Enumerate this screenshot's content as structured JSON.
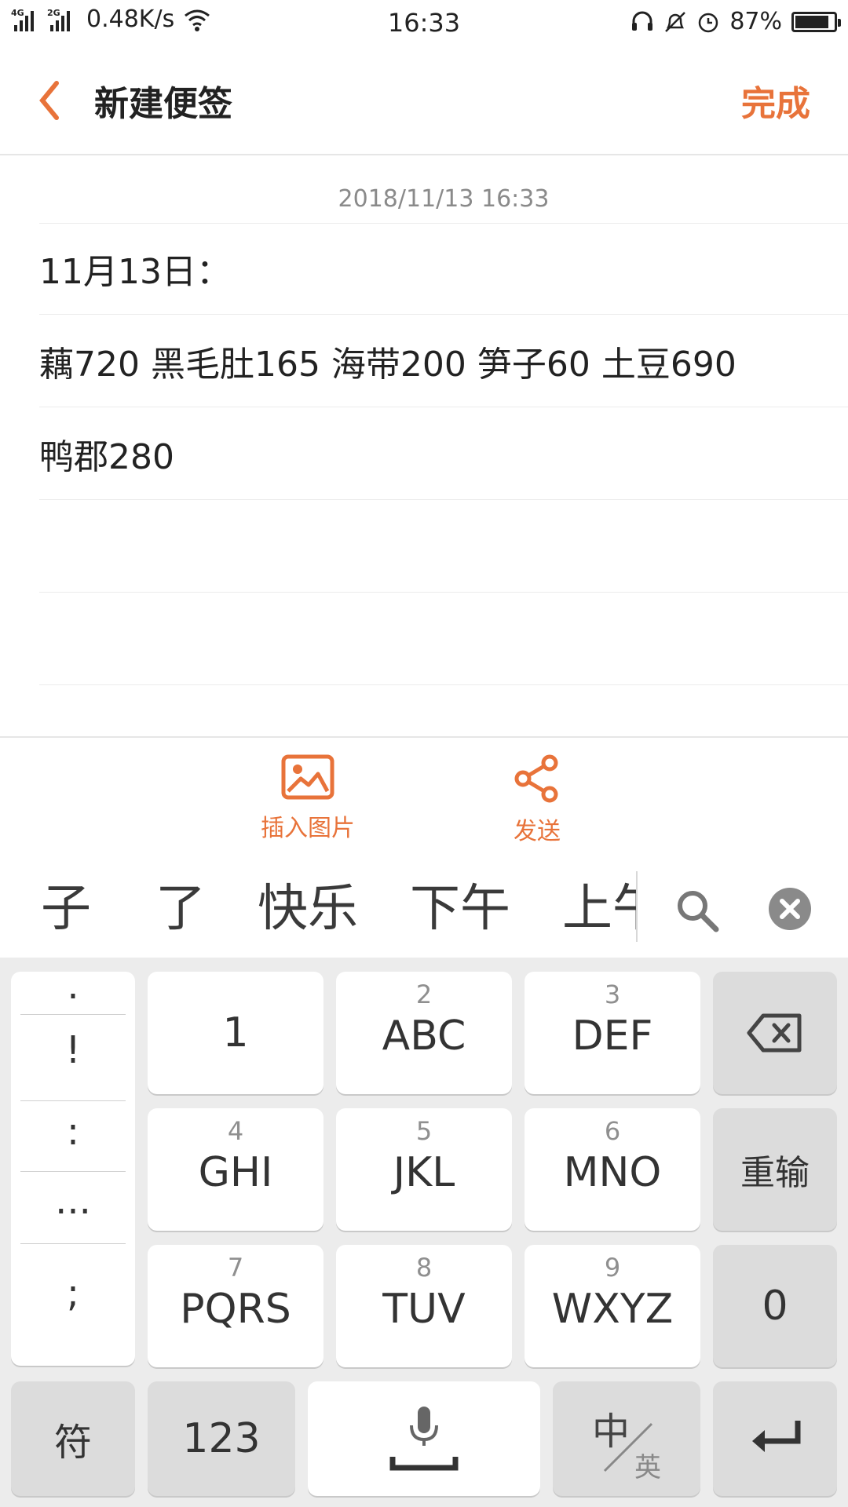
{
  "status_bar": {
    "net1": "4G",
    "net2": "2G",
    "speed": "0.48K/s",
    "time": "16:33",
    "battery": "87%",
    "battery_level": 0.87,
    "icons": [
      "signal-icon",
      "wifi-icon",
      "headset-icon",
      "mute-icon",
      "alarm-icon",
      "battery-icon"
    ]
  },
  "header": {
    "title": "新建便签",
    "done_label": "完成"
  },
  "note": {
    "date": "2018/11/13 16:33",
    "lines": [
      "11月13日：",
      "藕720  黑毛肚165  海带200  笋子60  土豆690",
      "鸭郡280"
    ]
  },
  "toolbar": {
    "insert_image": "插入图片",
    "send": "发送"
  },
  "candidates": [
    "子",
    "了",
    "快乐",
    "下午",
    "上午"
  ],
  "keyboard": {
    "punctuation": [
      ".",
      "!",
      ":",
      "...",
      ";"
    ],
    "keys": [
      {
        "num": "",
        "main": "1"
      },
      {
        "num": "2",
        "main": "ABC"
      },
      {
        "num": "3",
        "main": "DEF"
      },
      {
        "num": "4",
        "main": "GHI"
      },
      {
        "num": "5",
        "main": "JKL"
      },
      {
        "num": "6",
        "main": "MNO"
      },
      {
        "num": "7",
        "main": "PQRS"
      },
      {
        "num": "8",
        "main": "TUV"
      },
      {
        "num": "9",
        "main": "WXYZ"
      }
    ],
    "reinput": "重输",
    "zero": "0",
    "symbols": "符",
    "numbers": "123",
    "lang_zh": "中",
    "lang_en": "英"
  },
  "colors": {
    "accent": "#e8733a"
  }
}
